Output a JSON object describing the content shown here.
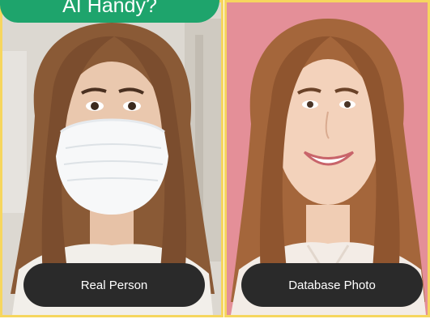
{
  "banner": {
    "text": "AI Handy?"
  },
  "panels": [
    {
      "caption": "Real Person",
      "subject": "woman wearing face mask",
      "background": "#d8d3cb"
    },
    {
      "caption": "Database Photo",
      "subject": "smiling woman",
      "background": "#e48f98"
    }
  ],
  "colors": {
    "panel_border": "#f6d65e",
    "banner": "#1ea46c",
    "caption_bg": "#2a2a2a",
    "caption_text": "#ffffff"
  }
}
